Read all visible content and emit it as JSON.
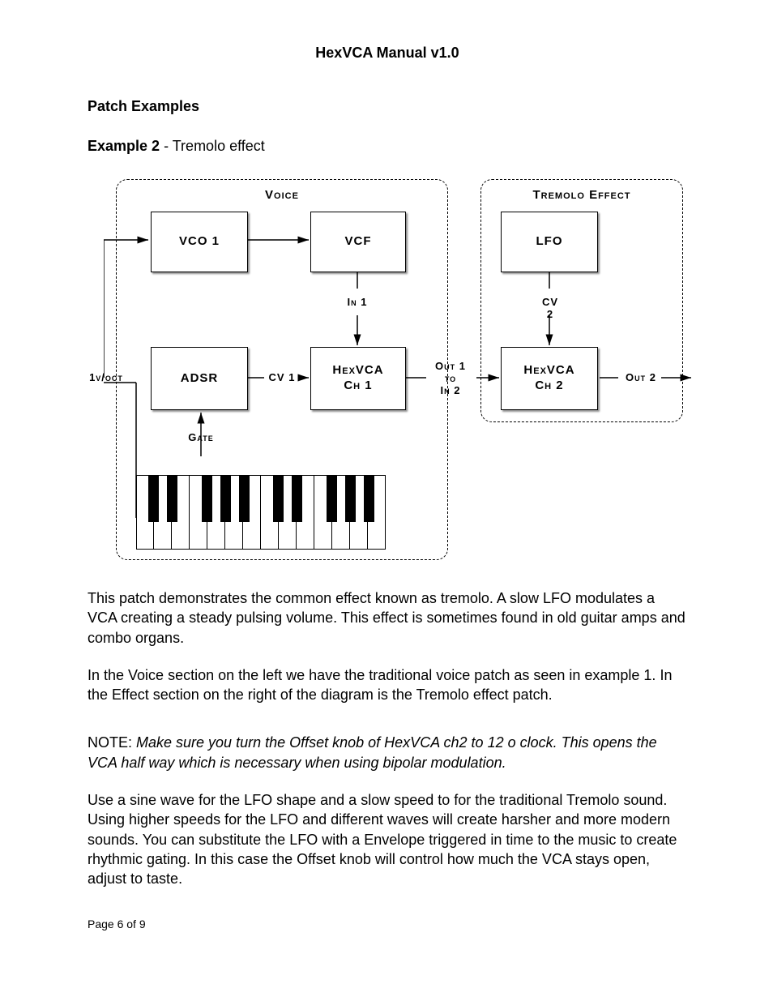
{
  "doc": {
    "title": "HexVCA Manual v1.0",
    "section": "Patch Examples",
    "example_label": "Example 2",
    "example_desc": " - Tremolo effect",
    "p1": "This patch demonstrates the common effect known as tremolo. A slow LFO modulates a VCA creating a steady pulsing volume. This effect is sometimes found in old guitar amps and combo organs.",
    "p2": "In the Voice section on the left we have the traditional voice patch as seen in example 1. In the Effect section on the right of the diagram is the Tremolo effect patch.",
    "note_label": "NOTE: ",
    "note_body": "Make sure you turn the Offset knob of HexVCA ch2 to 12 o clock. This opens the VCA half way which is necessary when using bipolar modulation.",
    "p3": "Use a sine wave for the LFO shape and a slow speed to for the traditional Tremolo sound. Using higher speeds for the LFO and different waves will create harsher and more modern sounds. You can substitute the LFO with a Envelope triggered in time to the music to create rhythmic gating. In this case the Offset knob will control how much the VCA stays open, adjust to taste.",
    "page_indicator": "Page 6 of 9"
  },
  "diagram": {
    "groups": {
      "voice": "Voice",
      "tremolo": "Tremolo Effect"
    },
    "boxes": {
      "vco1": "VCO 1",
      "vcf": "VCF",
      "adsr": "ADSR",
      "hex1": "HexVCA\nCh 1",
      "lfo": "LFO",
      "hex2": "HexVCA\nCh 2"
    },
    "labels": {
      "in1": "In 1",
      "cv1": "CV 1",
      "cv2": "CV 2",
      "voct": "1v/oct",
      "gate": "Gate",
      "out1": "Out 1\nto\nIn 2",
      "out2": "Out 2"
    }
  }
}
